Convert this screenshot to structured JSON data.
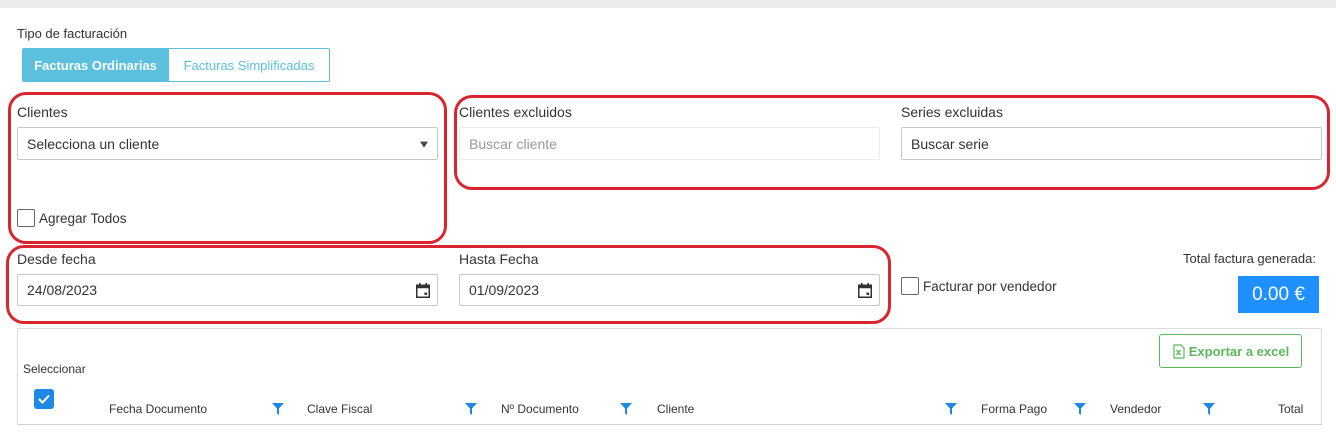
{
  "billing_type": {
    "label": "Tipo de facturación",
    "options": [
      "Facturas Ordinarias",
      "Facturas Simplificadas"
    ],
    "selected": "Facturas Ordinarias"
  },
  "clients": {
    "label": "Clientes",
    "select_value": "Selecciona un cliente",
    "add_all_label": "Agregar Todos",
    "add_all_checked": false
  },
  "excluded_clients": {
    "label": "Clientes excluidos",
    "placeholder": "Buscar cliente"
  },
  "excluded_series": {
    "label": "Series excluidas",
    "value": "Buscar serie"
  },
  "dates": {
    "from_label": "Desde fecha",
    "from_value": "24/08/2023",
    "to_label": "Hasta Fecha",
    "to_value": "01/09/2023"
  },
  "by_seller": {
    "label": "Facturar por vendedor",
    "checked": false
  },
  "total": {
    "label": "Total factura generada:",
    "value": "0.00 €"
  },
  "table": {
    "select_label": "Seleccionar",
    "select_all_checked": true,
    "export_label": "Exportar a excel",
    "columns": [
      "Fecha Documento",
      "Clave Fiscal",
      "Nº Documento",
      "Cliente",
      "Forma Pago",
      "Vendedor",
      "Total"
    ]
  },
  "colors": {
    "primary": "#5bc0de",
    "highlight": "#d9252f",
    "accent_blue": "#1e90ff",
    "excel_green": "#5cb85c"
  },
  "icons": [
    "calendar-icon",
    "select-caret-icon",
    "filter-icon",
    "excel-icon",
    "check-icon"
  ]
}
